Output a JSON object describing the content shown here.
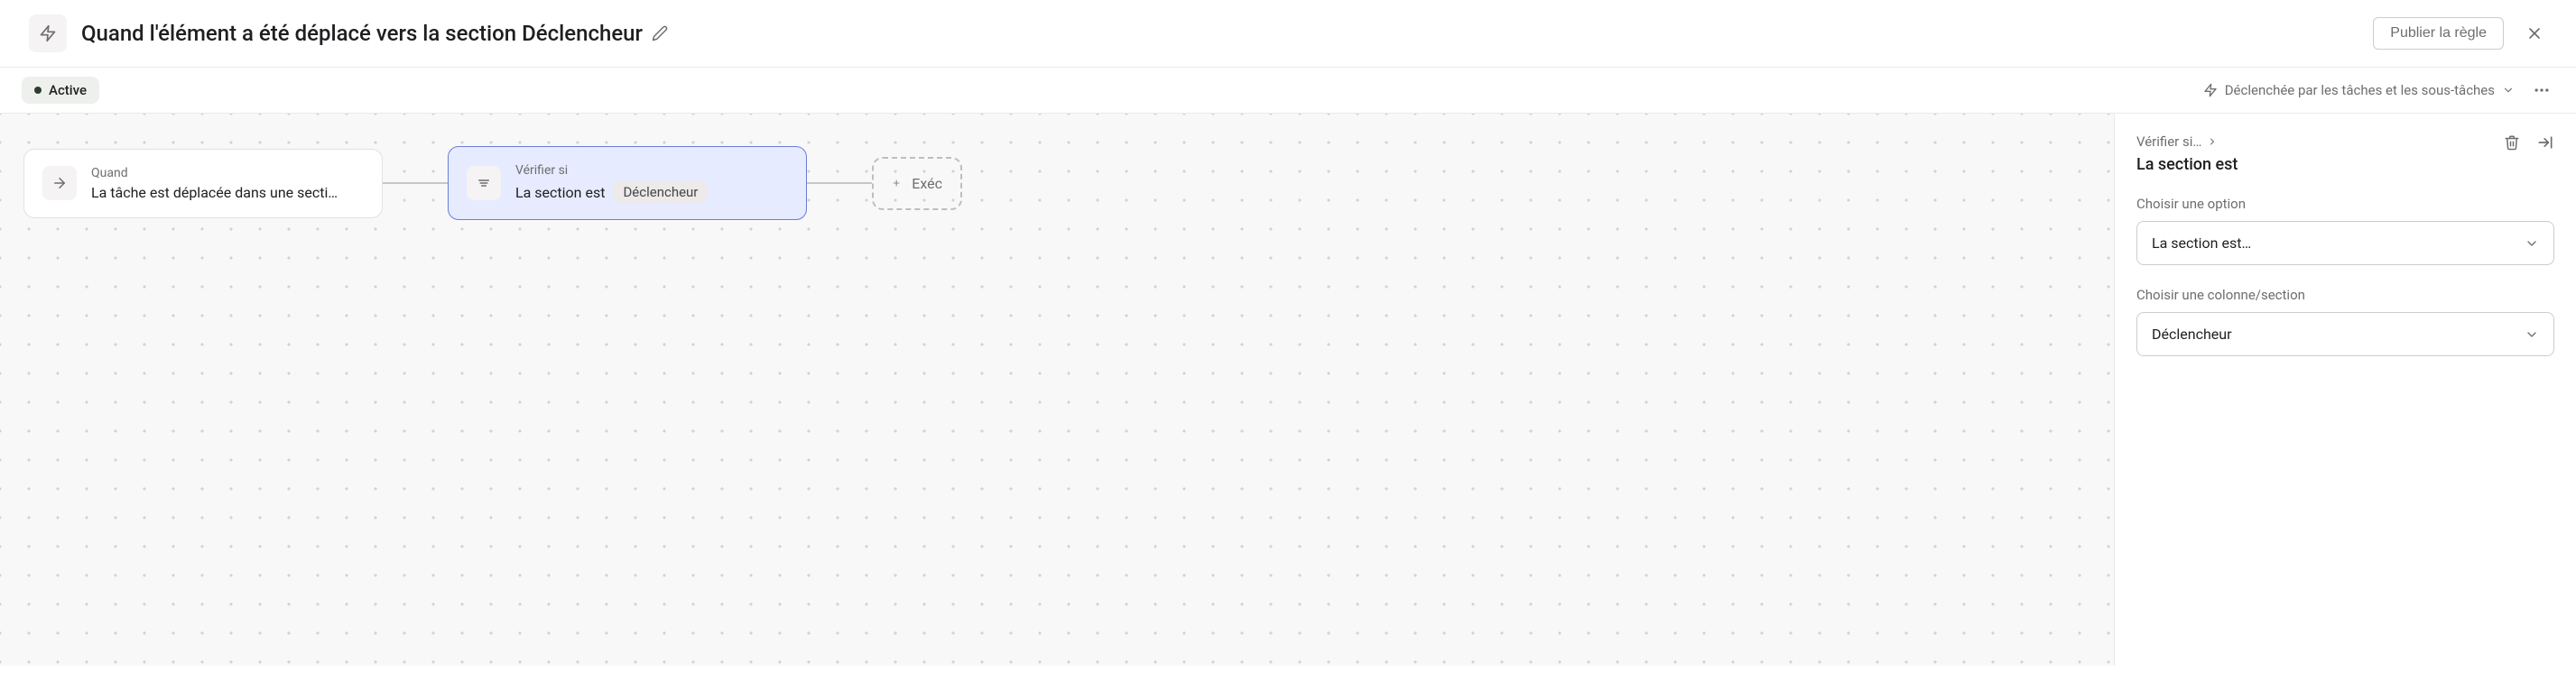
{
  "header": {
    "title": "Quand l'élément a été déplacé vers la section Déclencheur",
    "publish_label": "Publier la règle"
  },
  "status": {
    "label": "Active",
    "trigger_label": "Déclenchée par les tâches et les sous-tâches"
  },
  "flow": {
    "when_card": {
      "label": "Quand",
      "text": "La tâche est déplacée dans une secti…"
    },
    "check_card": {
      "label": "Vérifier si",
      "text": "La section est",
      "chip": "Déclencheur"
    },
    "add_card": {
      "label": "Exéc"
    }
  },
  "panel": {
    "breadcrumb": "Vérifier si…",
    "title": "La section est",
    "option_field": {
      "label": "Choisir une option",
      "value": "La section est…"
    },
    "column_field": {
      "label": "Choisir une colonne/section",
      "value": "Déclencheur"
    }
  }
}
